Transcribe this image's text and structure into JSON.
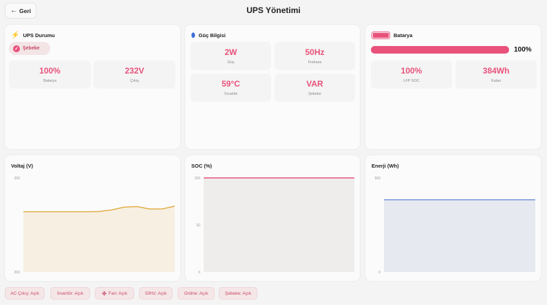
{
  "header": {
    "back_label": "Geri",
    "title": "UPS Yönetimi"
  },
  "ups": {
    "title": "UPS Durumu",
    "mode": "Şebeke",
    "stats": [
      {
        "value": "100%",
        "label": "Batarya"
      },
      {
        "value": "232V",
        "label": "Çıkış"
      }
    ]
  },
  "power": {
    "title": "Güç Bilgisi",
    "stats": [
      {
        "value": "2W",
        "label": "Güç"
      },
      {
        "value": "50Hz",
        "label": "Frekans"
      },
      {
        "value": "59°C",
        "label": "Sıcaklık"
      },
      {
        "value": "VAR",
        "label": "Şebeke"
      }
    ]
  },
  "battery": {
    "title": "Batarya",
    "level": 1.0,
    "percent": "100%",
    "stats": [
      {
        "value": "100%",
        "label": "LFP SOC"
      },
      {
        "value": "384Wh",
        "label": "Kalan"
      }
    ]
  },
  "charts": [
    {
      "title": "Voltaj (V)",
      "ticks": [
        "250",
        "200"
      ]
    },
    {
      "title": "SOC (%)",
      "ticks": [
        "100",
        "50",
        "0"
      ]
    },
    {
      "title": "Enerji (Wh)",
      "ticks": [
        "500",
        "0"
      ]
    }
  ],
  "chart_data": [
    {
      "type": "area",
      "title": "Voltaj (V)",
      "ylim": [
        200,
        250
      ],
      "values": [
        232,
        232,
        232,
        232,
        232,
        232,
        232.2,
        233,
        234.5,
        234.8,
        233.5,
        233.5,
        235
      ],
      "color": "#e0a93a",
      "fill": "#f6efe2"
    },
    {
      "type": "area",
      "title": "SOC (%)",
      "ylim": [
        0,
        100
      ],
      "values": [
        100,
        100
      ],
      "color": "#e8527b",
      "fill": "#efedec"
    },
    {
      "type": "area",
      "title": "Enerji (Wh)",
      "ylim": [
        0,
        500
      ],
      "values": [
        384,
        384
      ],
      "color": "#6a8fd6",
      "fill": "#e6eaf0"
    }
  ],
  "status_pills": [
    {
      "label": "AC Çıkış: Açık",
      "icon": ""
    },
    {
      "label": "İnvertör: Açık",
      "icon": ""
    },
    {
      "label": "Fan: Açık",
      "icon": "fan-icon"
    },
    {
      "label": "50Hz: Açık",
      "icon": ""
    },
    {
      "label": "Online: Açık",
      "icon": ""
    },
    {
      "label": "Şebeke: Açık",
      "icon": ""
    }
  ],
  "colors": {
    "accent": "#e8527b",
    "voltage": "#e0a93a",
    "energy": "#6a8fd6",
    "power_icon": "#3b6fd8"
  }
}
